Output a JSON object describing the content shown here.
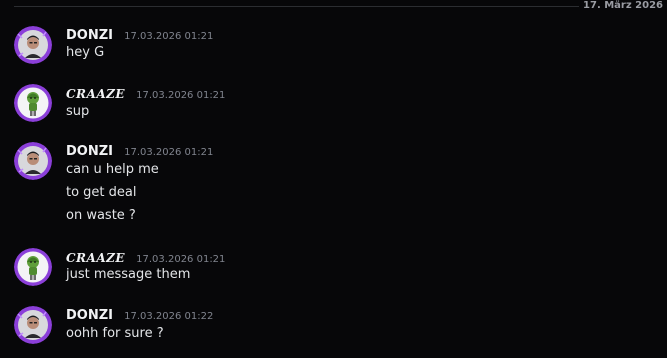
{
  "divider": {
    "date": "17. März 2026"
  },
  "messages": [
    {
      "author": "DONZI",
      "timestamp": "17.03.2026 01:21",
      "avatar_icon": "person-avatar-icon",
      "lines": [
        "hey G"
      ]
    },
    {
      "author": "CRAAZE",
      "timestamp": "17.03.2026 01:21",
      "avatar_icon": "green-character-avatar-icon",
      "lines": [
        "sup"
      ]
    },
    {
      "author": "DONZI",
      "timestamp": "17.03.2026 01:21",
      "avatar_icon": "person-avatar-icon",
      "lines": [
        "can u help me",
        "to get deal",
        "on waste ?"
      ]
    },
    {
      "author": "CRAAZE",
      "timestamp": "17.03.2026 01:21",
      "avatar_icon": "green-character-avatar-icon",
      "lines": [
        "just message them"
      ]
    },
    {
      "author": "DONZI",
      "timestamp": "17.03.2026 01:22",
      "avatar_icon": "person-avatar-icon",
      "lines": [
        "oohh for sure ?"
      ]
    }
  ],
  "colors": {
    "background": "#070709",
    "avatar_ring_purple": "#8b3fd9",
    "username": "#f2f3f5",
    "timestamp": "#80848e",
    "message_text": "#e3e5e8"
  }
}
